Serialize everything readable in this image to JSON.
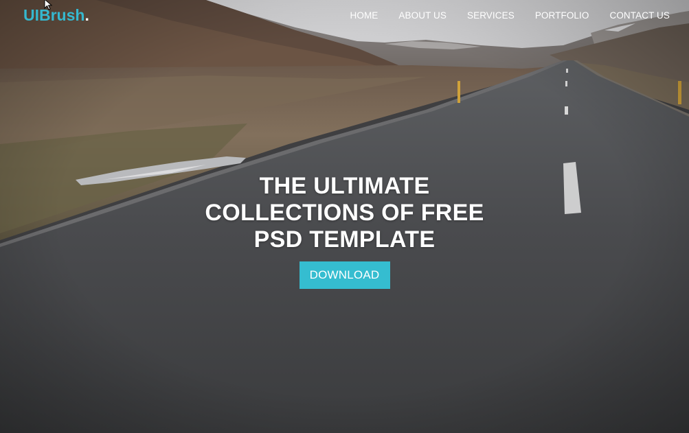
{
  "brand": {
    "name": "UIBrush",
    "dot": ".",
    "accent_color": "#35b8cf"
  },
  "nav": {
    "items": [
      {
        "label": "HOME"
      },
      {
        "label": "ABOUT US"
      },
      {
        "label": "SERVICES"
      },
      {
        "label": "PORTFOLIO"
      },
      {
        "label": "CONTACT US"
      }
    ]
  },
  "hero": {
    "title_lines": [
      "THE ULTIMATE",
      "COLLECTIONS OF FREE",
      "PSD TEMPLATE"
    ],
    "cta_label": "DOWNLOAD",
    "cta_color": "#35bdd0",
    "background": "road-landscape-photo"
  },
  "cursor": {
    "icon": "mouse-pointer-icon"
  }
}
